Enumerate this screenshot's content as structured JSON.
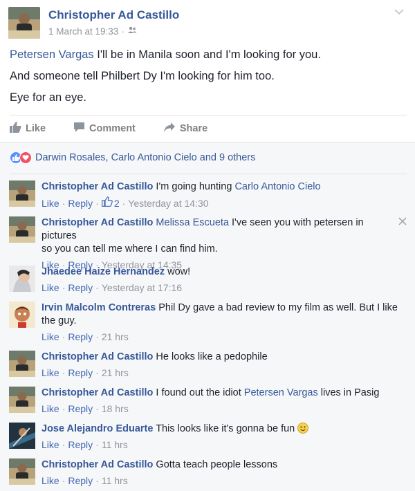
{
  "post": {
    "author": "Christopher Ad Castillo",
    "timestamp": "1 March at 19:33",
    "meta_separator": " · ",
    "audience_icon": "friends-icon",
    "lines": [
      {
        "mention": "Petersen Vargas",
        "text": " I'll be in Manila soon and I'm looking for you."
      },
      {
        "text": "And someone tell Philbert Dy I'm looking for him too."
      },
      {
        "text": "Eye for an eye."
      }
    ]
  },
  "actions": {
    "like": "Like",
    "comment": "Comment",
    "share": "Share"
  },
  "reactions": {
    "text": "Darwin Rosales, Carlo Antonio Cielo and 9 others",
    "icons": [
      "like-reaction-icon",
      "love-reaction-icon"
    ]
  },
  "comments": [
    {
      "author": "Christopher Ad Castillo",
      "text_before": " I'm going hunting ",
      "mention": "Carlo Antonio Cielo",
      "text_after": "",
      "like": "Like",
      "reply": "Reply",
      "likes": "2",
      "time": "Yesterday at 14:30"
    },
    {
      "author": "Christopher Ad Castillo",
      "mention": "Melissa Escueta",
      "line1": " I've seen you with petersen in pictures",
      "line2": "so you can tell me where I can find him.",
      "like": "Like",
      "reply": "Reply",
      "time": "Yesterday at 14:35"
    },
    {
      "author": "Jhaedee Haize Hernandez",
      "text": " wow!",
      "like": "Like",
      "reply": "Reply",
      "time": "Yesterday at 17:16"
    },
    {
      "author": "Irvin Malcolm Contreras",
      "line1": " Phil Dy gave a bad review to my film as well. But I like",
      "line2": "the guy.",
      "like": "Like",
      "reply": "Reply",
      "time": "21 hrs"
    },
    {
      "author": "Christopher Ad Castillo",
      "text": " He looks like a pedophile",
      "like": "Like",
      "reply": "Reply",
      "time": "21 hrs"
    },
    {
      "author": "Christopher Ad Castillo",
      "text_before": " I found out the idiot ",
      "mention": "Petersen Vargas",
      "text_after": " lives in Pasig",
      "like": "Like",
      "reply": "Reply",
      "time": "18 hrs"
    },
    {
      "author": "Jose Alejandro Eduarte",
      "text": " This looks like it's gonna be fun",
      "like": "Like",
      "reply": "Reply",
      "time": "11 hrs"
    },
    {
      "author": "Christopher Ad Castillo",
      "text": " Gotta teach people lessons",
      "like": "Like",
      "reply": "Reply",
      "time": "11 hrs"
    }
  ],
  "colors": {
    "link": "#365899",
    "meta": "#90949c",
    "text": "#1d2129",
    "like_blue": "#5890ff",
    "love_red": "#f25268"
  }
}
